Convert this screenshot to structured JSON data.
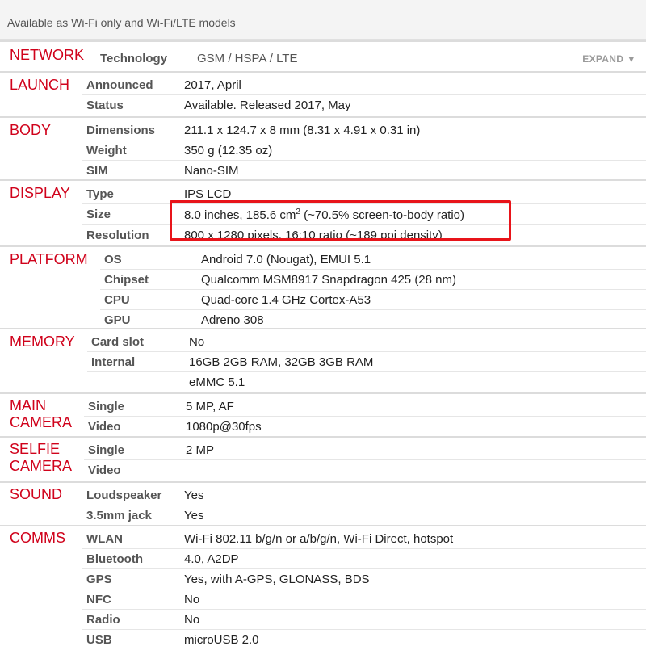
{
  "top_note": "Available as Wi-Fi only and Wi-Fi/LTE models",
  "expand_label": "EXPAND ▼",
  "sections": [
    {
      "title": "NETWORK",
      "rows": [
        {
          "label": "Technology",
          "value": "GSM / HSPA / LTE"
        }
      ]
    },
    {
      "title": "LAUNCH",
      "rows": [
        {
          "label": "Announced",
          "value": "2017, April"
        },
        {
          "label": "Status",
          "value": "Available. Released 2017, May"
        }
      ]
    },
    {
      "title": "BODY",
      "rows": [
        {
          "label": "Dimensions",
          "value": "211.1 x 124.7 x 8 mm (8.31 x 4.91 x 0.31 in)"
        },
        {
          "label": "Weight",
          "value": "350 g (12.35 oz)"
        },
        {
          "label": "SIM",
          "value": "Nano-SIM"
        }
      ]
    },
    {
      "title": "DISPLAY",
      "rows": [
        {
          "label": "Type",
          "value": "IPS LCD"
        },
        {
          "label": "Size",
          "value_pre": "8.0 inches, 185.6 cm",
          "value_sup": "2",
          "value_post": " (~70.5% screen-to-body ratio)"
        },
        {
          "label": "Resolution",
          "value": "800 x 1280 pixels, 16:10 ratio (~189 ppi density)"
        }
      ]
    },
    {
      "title": "PLATFORM",
      "rows": [
        {
          "label": "OS",
          "value": "Android 7.0 (Nougat), EMUI 5.1"
        },
        {
          "label": "Chipset",
          "value": "Qualcomm MSM8917 Snapdragon 425 (28 nm)"
        },
        {
          "label": "CPU",
          "value": "Quad-core 1.4 GHz Cortex-A53"
        },
        {
          "label": "GPU",
          "value": "Adreno 308"
        }
      ]
    },
    {
      "title": "MEMORY",
      "rows": [
        {
          "label": "Card slot",
          "value": "No"
        },
        {
          "label": "Internal",
          "value": "16GB 2GB RAM, 32GB 3GB RAM"
        },
        {
          "label": "",
          "value": "eMMC 5.1"
        }
      ]
    },
    {
      "title": "MAIN\nCAMERA",
      "rows": [
        {
          "label": "Single",
          "value": "5 MP, AF"
        },
        {
          "label": "Video",
          "value": "1080p@30fps"
        }
      ]
    },
    {
      "title": "SELFIE\nCAMERA",
      "rows": [
        {
          "label": "Single",
          "value": "2 MP"
        },
        {
          "label": "Video",
          "value": ""
        }
      ]
    },
    {
      "title": "SOUND",
      "rows": [
        {
          "label": "Loudspeaker",
          "value": "Yes"
        },
        {
          "label": "3.5mm jack",
          "value": "Yes"
        }
      ]
    },
    {
      "title": "COMMS",
      "rows": [
        {
          "label": "WLAN",
          "value": "Wi-Fi 802.11 b/g/n or a/b/g/n, Wi-Fi Direct, hotspot"
        },
        {
          "label": "Bluetooth",
          "value": "4.0, A2DP"
        },
        {
          "label": "GPS",
          "value": "Yes, with A-GPS, GLONASS, BDS"
        },
        {
          "label": "NFC",
          "value": "No"
        },
        {
          "label": "Radio",
          "value": "No"
        },
        {
          "label": "USB",
          "value": "microUSB 2.0"
        }
      ]
    }
  ]
}
